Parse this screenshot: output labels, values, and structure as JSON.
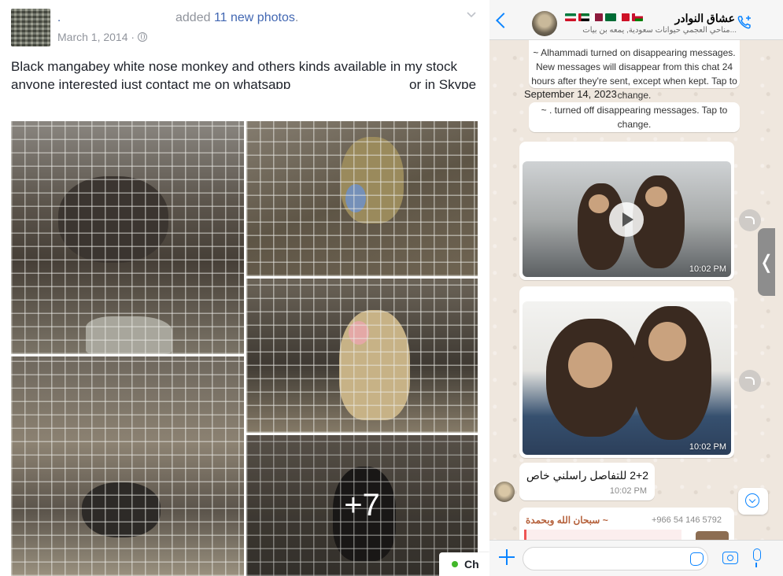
{
  "facebook": {
    "author_name": ".",
    "added_text_prefix": "added",
    "added_count": "11 new photos",
    "added_text_suffix": ".",
    "date": "March 1, 2014 ·",
    "post_text_line1": "Black mangabey white nose monkey and others kinds available in my stock",
    "post_text_line2": "anyone interested just contact me on whatsapp",
    "post_text_line2_end": "or in Skype",
    "more_photos_label": "+7",
    "chat_label": "Ch",
    "icons": [
      "globe-icon",
      "chevron-down-icon"
    ]
  },
  "whatsapp": {
    "group_title": "عشاق النوادر",
    "group_subtitle": "...مناحي العجمي حيوانات سعودية, يمعه بن بيات",
    "system_message_1": "~ Alhammadi turned on disappearing messages. New messages will disappear from this chat 24 hours after they're sent, except when kept. Tap to change.",
    "date_label": "September 14, 2023",
    "system_message_2": "~ . turned off disappearing messages. Tap to change.",
    "video_time": "10:02 PM",
    "photo_time": "10:02 PM",
    "text_message": "2+2 للتفاصل راسلني خاص",
    "text_time": "10:02 PM",
    "quote_phone": "+966 54 146 5792",
    "quote_name": "~ سبحان الله وبحمدة",
    "side_tab_glyph": "❬",
    "flag_colors": [
      "#006c35",
      "#ce1126",
      "#00732f",
      "#8d1b3d",
      "#006c35",
      "#ce1126",
      "#c8102e"
    ],
    "accent_color": "#0a84ff",
    "icons": [
      "back-icon",
      "call-add-icon",
      "play-icon",
      "forward-icon",
      "scroll-down-icon",
      "plus-icon",
      "sticker-icon",
      "camera-icon",
      "mic-icon"
    ]
  }
}
